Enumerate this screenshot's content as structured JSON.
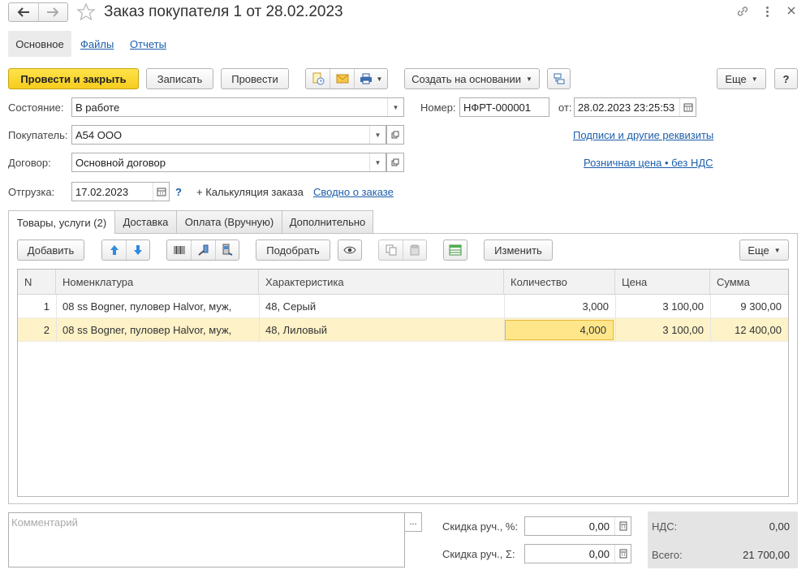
{
  "window": {
    "title": "Заказ покупателя 1 от 28.02.2023"
  },
  "nav_tabs": {
    "main": "Основное",
    "files": "Файлы",
    "reports": "Отчеты"
  },
  "toolbar": {
    "post_close": "Провести и закрыть",
    "save": "Записать",
    "post": "Провести",
    "create_based": "Создать на основании",
    "more": "Еще",
    "help": "?"
  },
  "form": {
    "state_label": "Состояние:",
    "state_value": "В работе",
    "number_label": "Номер:",
    "number_value": "НФРТ-000001",
    "date_label": "от:",
    "date_value": "28.02.2023 23:25:53",
    "buyer_label": "Покупатель:",
    "buyer_value": "А54 ООО",
    "contract_label": "Договор:",
    "contract_value": "Основной договор",
    "shipment_label": "Отгрузка:",
    "shipment_value": "17.02.2023",
    "shipment_help": "?",
    "calc_link": "+ Калькуляция заказа",
    "summary_link": "Сводно о заказе",
    "signatures_link": "Подписи и другие реквизиты",
    "price_link": "Розничная цена • без НДС"
  },
  "content_tabs": [
    {
      "label": "Товары, услуги (2)"
    },
    {
      "label": "Доставка"
    },
    {
      "label": "Оплата (Вручную)"
    },
    {
      "label": "Дополнительно"
    }
  ],
  "table_toolbar": {
    "add": "Добавить",
    "pick": "Подобрать",
    "change": "Изменить",
    "more": "Еще"
  },
  "table": {
    "columns": [
      "N",
      "Номенклатура",
      "Характеристика",
      "Количество",
      "Цена",
      "Сумма"
    ],
    "rows": [
      {
        "n": "1",
        "item": "08 ss Bogner, пуловер Halvor, муж,",
        "char": "48, Серый",
        "qty": "3,000",
        "price": "3 100,00",
        "sum": "9 300,00"
      },
      {
        "n": "2",
        "item": "08 ss Bogner, пуловер Halvor, муж,",
        "char": "48, Лиловый",
        "qty": "4,000",
        "price": "3 100,00",
        "sum": "12 400,00"
      }
    ]
  },
  "footer": {
    "comment_placeholder": "Комментарий",
    "comment_btn": "...",
    "discount_pct_label": "Скидка руч., %:",
    "discount_pct_value": "0,00",
    "discount_sum_label": "Скидка руч., Σ:",
    "discount_sum_value": "0,00",
    "vat_label": "НДС:",
    "vat_value": "0,00",
    "total_label": "Всего:",
    "total_value": "21 700,00"
  },
  "colors": {
    "accent_yellow": "#f6cc1d",
    "selected_row": "#fdf2c8",
    "selected_cell": "#ffe68a",
    "link": "#1c5eaa"
  }
}
